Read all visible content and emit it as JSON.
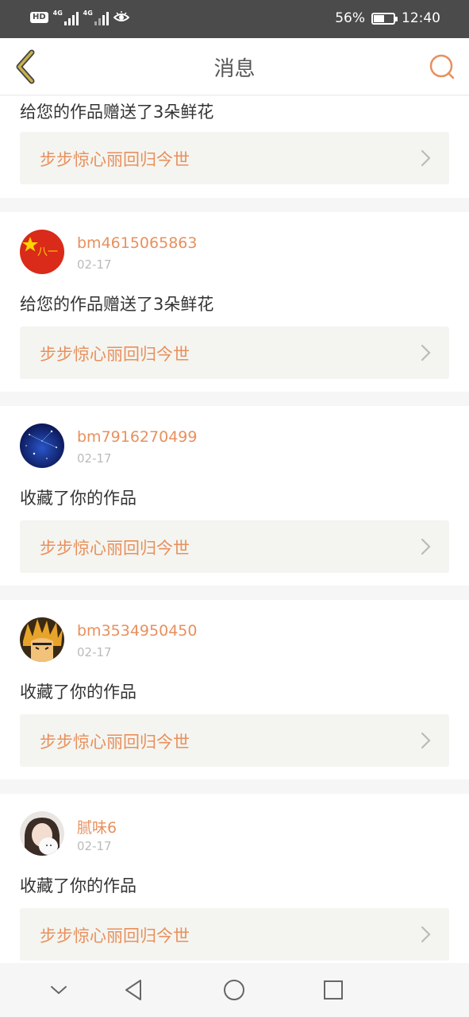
{
  "status_bar": {
    "hd_label": "HD",
    "sim1_network": "4G",
    "sim2_network": "4G",
    "battery_percent": "56%",
    "battery_level": 0.56,
    "time": "12:40",
    "icons": [
      "hd-icon",
      "signal-icon",
      "signal-icon",
      "eye-icon",
      "battery-icon"
    ]
  },
  "header": {
    "title": "消息",
    "back_icon": "chevron-left-icon",
    "search_icon": "search-icon",
    "accent_color": "#e8905e",
    "back_color": "#c8b24a"
  },
  "messages": [
    {
      "action": "给您的作品赠送了3朵鲜花",
      "work_title": "步步惊心丽回归今世"
    },
    {
      "username": "bm4615065863",
      "date": "02-17",
      "action": "给您的作品赠送了3朵鲜花",
      "work_title": "步步惊心丽回归今世",
      "avatar_text": "八一"
    },
    {
      "username": "bm7916270499",
      "date": "02-17",
      "action": "收藏了你的作品",
      "work_title": "步步惊心丽回归今世"
    },
    {
      "username": "bm3534950450",
      "date": "02-17",
      "action": "收藏了你的作品",
      "work_title": "步步惊心丽回归今世"
    },
    {
      "username": "腻味6",
      "date": "02-17",
      "action": "收藏了你的作品",
      "work_title": "步步惊心丽回归今世"
    }
  ],
  "system_nav": [
    "chevron-down-icon",
    "back-triangle-icon",
    "home-circle-icon",
    "recents-square-icon"
  ]
}
